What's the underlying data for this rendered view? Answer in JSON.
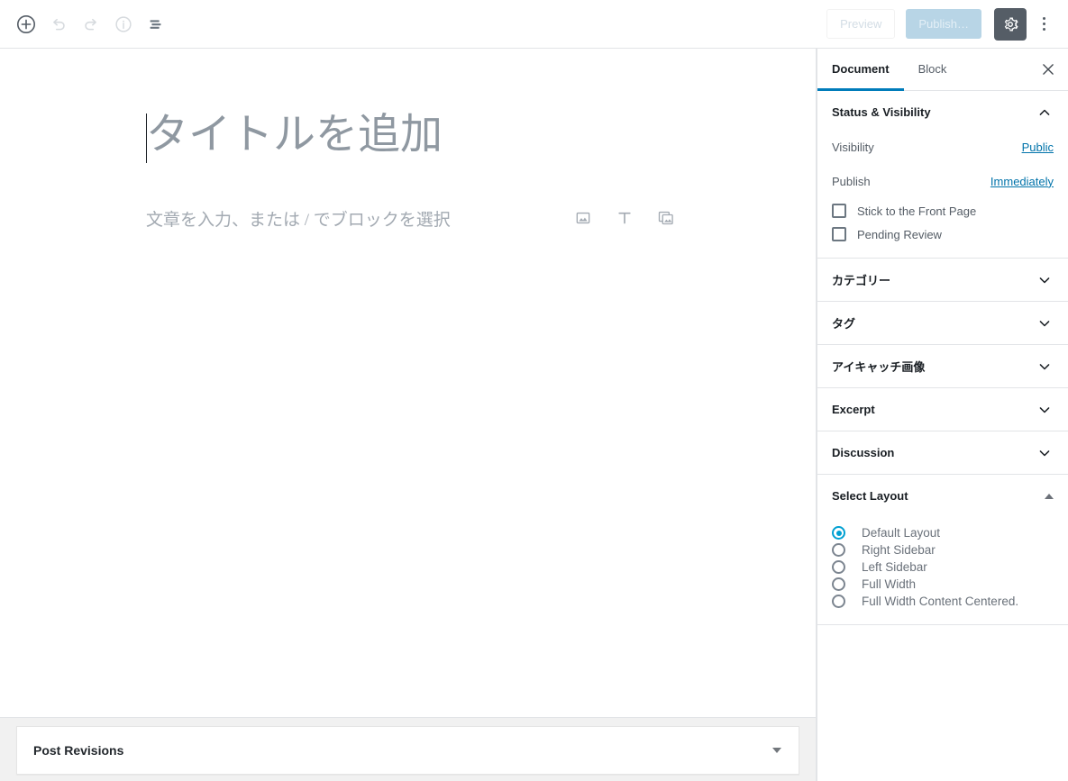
{
  "toolbar": {
    "left_buttons": [
      {
        "name": "add-block-button",
        "icon": "plus-circle-icon",
        "label": "ブロック追加",
        "disabled": false
      },
      {
        "name": "undo-button",
        "icon": "undo-icon",
        "label": "元に戻す",
        "disabled": true
      },
      {
        "name": "redo-button",
        "icon": "redo-icon",
        "label": "やり直す",
        "disabled": true
      },
      {
        "name": "content-info-button",
        "icon": "info-circle-icon",
        "label": "コンテンツ構造",
        "disabled": true
      },
      {
        "name": "block-navigation-button",
        "icon": "list-view-icon",
        "label": "ブロックナビゲーション",
        "disabled": false
      }
    ],
    "preview_label": "Preview",
    "publish_label": "Publish…",
    "settings_icon": "gear-icon",
    "more_menu_icon": "kebab-menu-icon",
    "gear_bg": "#555d66",
    "publish_bg": "#b8d5e6"
  },
  "editor": {
    "title_placeholder": "タイトルを追加",
    "paragraph_placeholder": "文章を入力、または / でブロックを選択",
    "quick_blocks": [
      {
        "name": "image-block-icon",
        "label": "画像"
      },
      {
        "name": "paragraph-block-icon",
        "label": "段落"
      },
      {
        "name": "gallery-block-icon",
        "label": "ギャラリー"
      }
    ]
  },
  "metabox": {
    "title": "Post Revisions",
    "toggle_icon": "triangle-down-icon"
  },
  "sidebar": {
    "tabs": [
      {
        "label": "Document",
        "active": true
      },
      {
        "label": "Block",
        "active": false
      }
    ],
    "close_icon": "close-icon",
    "accent_color": "#007cba",
    "link_color": "#0073aa",
    "status_panel": {
      "title": "Status & Visibility",
      "expanded": true,
      "rows": [
        {
          "label": "Visibility",
          "value": "Public"
        },
        {
          "label": "Publish",
          "value": "Immediately"
        }
      ],
      "checkboxes": [
        {
          "label": "Stick to the Front Page",
          "checked": false
        },
        {
          "label": "Pending Review",
          "checked": false
        }
      ]
    },
    "collapsed_panels": [
      {
        "title": "カテゴリー",
        "expanded": false
      },
      {
        "title": "タグ",
        "expanded": false
      },
      {
        "title": "アイキャッチ画像",
        "expanded": false
      },
      {
        "title": "Excerpt",
        "expanded": false
      },
      {
        "title": "Discussion",
        "expanded": false
      }
    ],
    "layout_panel": {
      "title": "Select Layout",
      "expanded": true,
      "options": [
        {
          "label": "Default Layout",
          "selected": true
        },
        {
          "label": "Right Sidebar",
          "selected": false
        },
        {
          "label": "Left Sidebar",
          "selected": false
        },
        {
          "label": "Full Width",
          "selected": false
        },
        {
          "label": "Full Width Content Centered.",
          "selected": false
        }
      ],
      "selected_color": "#00a0d2"
    }
  }
}
